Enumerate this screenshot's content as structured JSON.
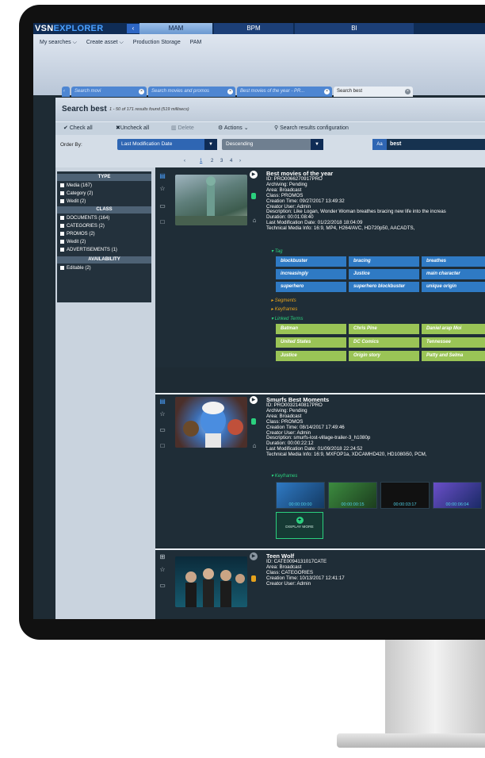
{
  "app": {
    "logo_a": "VSN",
    "logo_b": "EXPLORER",
    "modules": [
      "MAM",
      "BPM",
      "BI"
    ]
  },
  "menu": [
    "My searches ⌵",
    "Create asset ⌵",
    "Production Storage",
    "PAM"
  ],
  "tabs": [
    {
      "label": "Search movi"
    },
    {
      "label": "Search movies and promos"
    },
    {
      "label": "Best movies of the year - PR..."
    },
    {
      "label": "Search best"
    }
  ],
  "header": {
    "title": "Search best",
    "subtitle": "1 - 50 of 171 results found (519 millisecs)"
  },
  "toolbar": {
    "check_all": "Check all",
    "uncheck_all": "Uncheck all",
    "delete": "Delete",
    "actions": "Actions",
    "config": "Search results configuration"
  },
  "order": {
    "label": "Order By:",
    "field": "Last Modification Date",
    "direction": "Descending",
    "search_aa": "Aa",
    "search_value": "best"
  },
  "pager": [
    "‹",
    "1",
    "2",
    "3",
    "4",
    "›"
  ],
  "facets": {
    "type_header": "TYPE",
    "type_items": [
      "Media (167)",
      "Category (2)",
      "Wedit (2)"
    ],
    "class_header": "CLASS",
    "class_items": [
      "DOCUMENTS (164)",
      "CATEGORIES (2)",
      "PROMOS (2)",
      "Wedit (2)",
      "ADVERTISEMENTS (1)"
    ],
    "avail_header": "AVAILABILITY",
    "avail_items": [
      "Editable (2)"
    ]
  },
  "result1": {
    "title": "Best movies of the year",
    "lines": [
      "ID:  PRO0066270917PRO",
      "Archiving:   Pending",
      "Area:  Broadcast",
      "Class:  PROMOS",
      "Creation Time:   09/27/2017 13:49:32",
      "Creator User:   Admin",
      "Description:   Like Logan, Wonder Woman breathes bracing new life into the increas",
      "Duration:   00:01:08:40",
      "Last Modification Date:   01/22/2018 18:04:09",
      "Technical Media Info:   16:9, MP4, H264/AVC, HD720p50, AACADTS,"
    ],
    "tag_label": "Tag",
    "tags": [
      "blockbuster",
      "bracing",
      "breathes",
      "increasingly",
      "Justice",
      "main character",
      "superhero",
      "superhero blockbuster",
      "unique origin"
    ],
    "segments_label": "Segments",
    "keyframes_label": "Keyframes",
    "linked_label": "Linked Terms",
    "terms": [
      "Batman",
      "Chris Pine",
      "Daniel arap Moi",
      "United States",
      "DC Comics",
      "Tennessee",
      "Justice",
      "Origin story",
      "Patty and Selma"
    ]
  },
  "result2": {
    "title": "Smurfs Best Moments",
    "lines": [
      "ID:   PRO0032140817PRO",
      "Archiving:   Pending",
      "Area:   Broadcast",
      "Class:   PROMOS",
      "Creation Time:   08/14/2017 17:49:46",
      "Creator User:   Admin",
      "Description:   smurfs-lost-village-trailer-3_h1080p",
      "Duration:   00:00:22:12",
      "Last Modification Date:   01/09/2018 22:24:52",
      "Technical Media Info:   16:9, MXFOP1a, XDCAMHD420, HD1080i50, PCM,"
    ],
    "keyframes_label": "Keyframes",
    "keyframe_times": [
      "00:00:00:00",
      "00:00:00:15",
      "00:00:03:17",
      "00:00:06:04"
    ],
    "display_more": "DISPLAY MORE"
  },
  "result3": {
    "title": "Teen Wolf",
    "lines": [
      "ID:   CATE0094131017CATE",
      "Area:   Broadcast",
      "Class:   CATEGORIES",
      "Creation Time:   10/13/2017 12:41:17",
      "Creator User:   Admin"
    ]
  }
}
